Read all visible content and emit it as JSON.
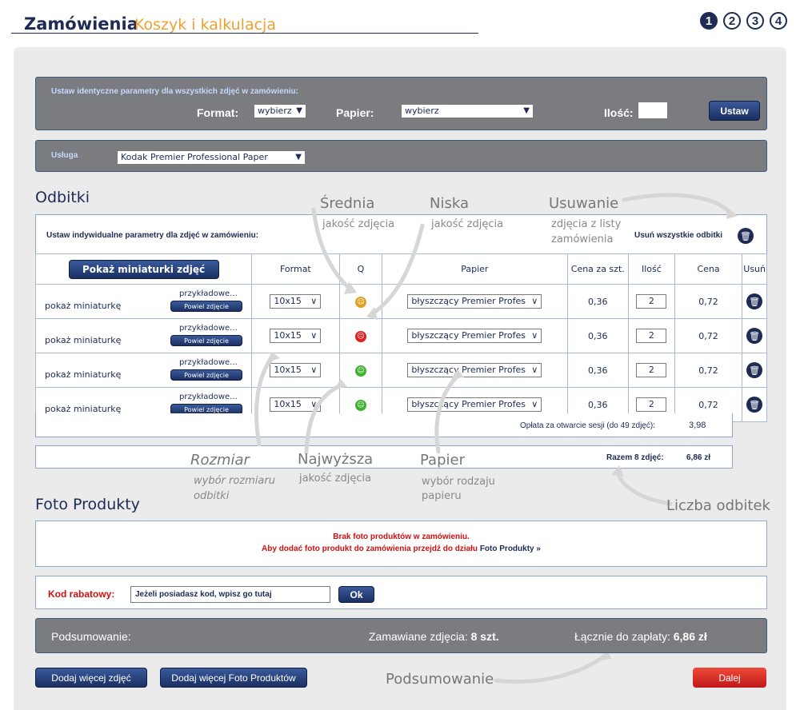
{
  "header": {
    "title": "Zamówienia",
    "subtitle": "Koszyk i kalkulacja",
    "steps": [
      "1",
      "2",
      "3",
      "4"
    ]
  },
  "bulk": {
    "heading": "Ustaw identyczne parametry dla wszystkich zdjęć w zamówieniu:",
    "format_label": "Format:",
    "format_value": "wybierz",
    "paper_label": "Papier:",
    "paper_value": "wybierz",
    "qty_label": "Ilość:",
    "qty_value": "",
    "set_button": "Ustaw"
  },
  "service": {
    "label": "Usługa",
    "value": "Kodak Premier Professional Paper"
  },
  "prints": {
    "title": "Odbitki",
    "individual_label": "Ustaw indywidualne parametry dla zdjęć w zamówieniu:",
    "delete_all": "Usuń wszystkie odbitki",
    "show_thumbs_button": "Pokaż miniaturki zdjęć",
    "columns": [
      "Format",
      "Q",
      "Papier",
      "Cena za szt.",
      "Ilość",
      "Cena",
      "Usuń"
    ],
    "rows": [
      {
        "thumb": "pokaż miniaturkę",
        "name": "przykładowe...",
        "dup": "Powiel zdjęcie",
        "format": "10x15",
        "quality": "medium",
        "paper": "błyszczący Premier Profes",
        "unit": "0,36",
        "qty": "2",
        "price": "0,72"
      },
      {
        "thumb": "pokaż miniaturkę",
        "name": "przykładowe...",
        "dup": "Powiel zdjęcie",
        "format": "10x15",
        "quality": "low",
        "paper": "błyszczący Premier Profes",
        "unit": "0,36",
        "qty": "2",
        "price": "0,72"
      },
      {
        "thumb": "pokaż miniaturkę",
        "name": "przykładowe...",
        "dup": "Powiel zdjęcie",
        "format": "10x15",
        "quality": "high",
        "paper": "błyszczący Premier Profes",
        "unit": "0,36",
        "qty": "2",
        "price": "0,72"
      },
      {
        "thumb": "pokaż miniaturkę",
        "name": "przykładowe...",
        "dup": "Powiel zdjęcie",
        "format": "10x15",
        "quality": "high",
        "paper": "błyszczący Premier Profes",
        "unit": "0,36",
        "qty": "2",
        "price": "0,72"
      }
    ],
    "session_fee_label": "Opłata za otwarcie sesji (do 49 zdjęć):",
    "session_fee_value": "3,98",
    "total_label": "Razem 8 zdjęć:",
    "total_value": "6,86 zł"
  },
  "annotations": {
    "avg_title": "Średnia",
    "avg_sub": "jakość zdjęcia",
    "low_title": "Niska",
    "low_sub": "jakość zdjęcia",
    "del_title": "Usuwanie",
    "del_sub1": "zdjęcia z listy",
    "del_sub2": "zamówienia",
    "size_title": "Rozmiar",
    "size_sub1": "wybór rozmiaru",
    "size_sub2": "odbitki",
    "best_title": "Najwyższa",
    "best_sub": "jakość zdjęcia",
    "paper_title": "Papier",
    "paper_sub1": "wybór rodzaju",
    "paper_sub2": "papieru",
    "count_title": "Liczba odbitek",
    "summary_title": "Podsumowanie"
  },
  "photo_products": {
    "title": "Foto Produkty",
    "empty_msg": "Brak foto produktów w zamówieniu.",
    "add_msg": "Aby dodać foto produkt do zamówienia przejdź do działu",
    "add_link": "Foto Produkty »"
  },
  "discount": {
    "label": "Kod rabatowy:",
    "placeholder": "Jeżeli posiadasz kod, wpisz go tutaj",
    "ok": "Ok"
  },
  "summary": {
    "label": "Podsumowanie:",
    "ordered_label": "Zamawiane zdjęcia:",
    "ordered_value": "8 szt.",
    "total_label": "Łącznie do zapłaty:",
    "total_value": "6,86 zł"
  },
  "footer": {
    "add_photos": "Dodaj więcej zdjęć",
    "add_products": "Dodaj więcej Foto Produktów",
    "next": "Dalej"
  },
  "colors": {
    "navy": "#1d2b55",
    "accent": "#f0a030",
    "quality_medium": "#e0a020",
    "quality_low": "#e02020",
    "quality_high": "#40b030",
    "next_button": "#d42020"
  }
}
